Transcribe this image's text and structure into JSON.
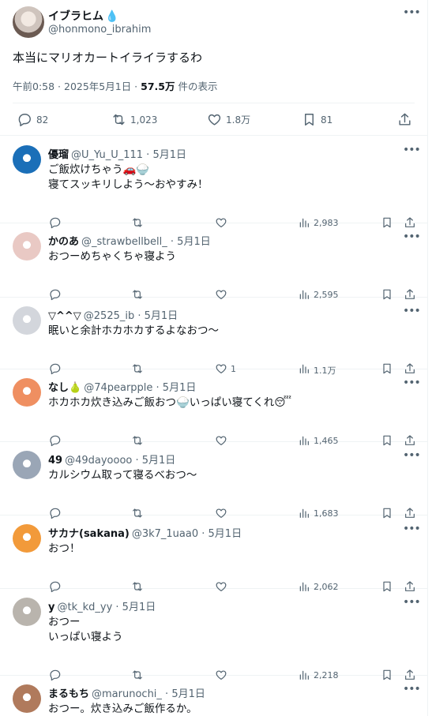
{
  "main_tweet": {
    "author_name": "イブラヒム",
    "author_badge": "💧",
    "author_handle": "@honmono_ibrahim",
    "text": "本当にマリオカートイライラするわ",
    "timestamp": "午前0:58 · 2025年5月1日 · ",
    "views_count": "57.5万",
    "views_suffix": " 件の表示",
    "replies": "82",
    "reposts": "1,023",
    "likes": "1.8万",
    "bookmarks": "81"
  },
  "replies": [
    {
      "name": "優瑠",
      "handle": "@U_Yu_U_111 · 5月1日",
      "lines": [
        "ご飯炊けちゃう🚗🍚",
        "寝てスッキリしよう～おやすみ！"
      ],
      "likes": "",
      "views": "2,983",
      "avatar_color": "#1b6fb8"
    },
    {
      "name": "かのあ",
      "handle": "@_strawbellbell_ · 5月1日",
      "lines": [
        "おつーめちゃくちゃ寝よう"
      ],
      "likes": "",
      "views": "2,595",
      "avatar_color": "#e9c9c4"
    },
    {
      "name": "▽^^▽",
      "handle": "@2525_ib · 5月1日",
      "lines": [
        "眠いと余計ホカホカするよなおつ～"
      ],
      "likes": "1",
      "views": "1.1万",
      "avatar_color": "#d3d6dc"
    },
    {
      "name": "なし🍐",
      "handle": "@74pearpple · 5月1日",
      "lines": [
        "ホカホカ炊き込みご飯おつ🍚いっぱい寝てくれ😴"
      ],
      "likes": "",
      "views": "1,465",
      "avatar_color": "#ef8f61"
    },
    {
      "name": "49",
      "handle": "@49dayoooo · 5月1日",
      "lines": [
        "カルシウム取って寝るべおつ～"
      ],
      "likes": "",
      "views": "1,683",
      "avatar_color": "#9aa6b6"
    },
    {
      "name": "サカナ(sakana)",
      "handle": "@3k7_1uaa0 · 5月1日",
      "lines": [
        "おつ！"
      ],
      "likes": "",
      "views": "2,062",
      "avatar_color": "#f29a3a"
    },
    {
      "name": "y",
      "handle": "@tk_kd_yy · 5月1日",
      "lines": [
        "おつー",
        "いっぱい寝よう"
      ],
      "likes": "",
      "views": "2,218",
      "avatar_color": "#b9b4ad"
    },
    {
      "name": "まるもち",
      "handle": "@marunochi_ · 5月1日",
      "lines": [
        "おつー。炊き込みご飯作るか。"
      ],
      "likes": "",
      "views": "",
      "avatar_color": "#b07a5c"
    }
  ],
  "colors": {
    "text": "#0f1419",
    "secondary": "#536471",
    "border": "#eff3f4",
    "accent": "#1d9bf0"
  }
}
